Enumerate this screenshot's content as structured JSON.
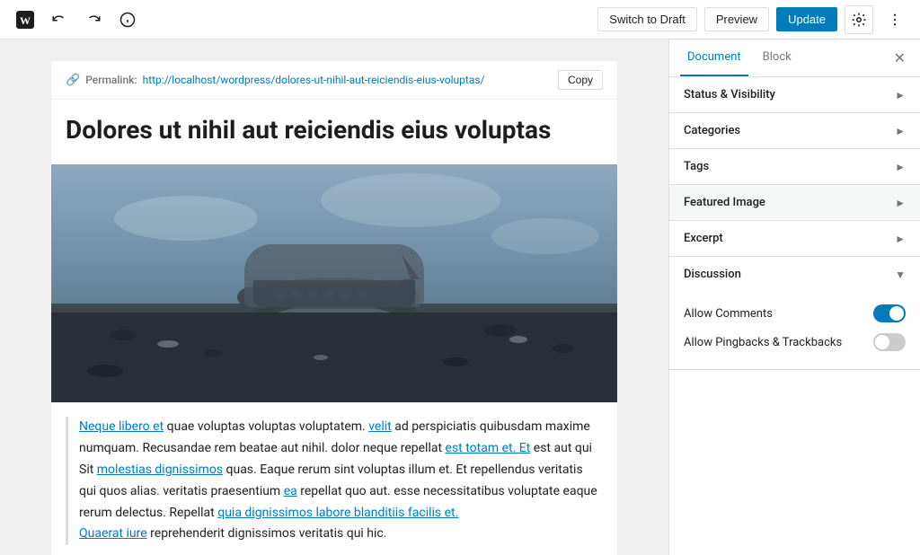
{
  "toolbar": {
    "wp_logo_icon": "W",
    "undo_icon": "↩",
    "redo_icon": "↪",
    "info_icon": "ℹ",
    "switch_draft_label": "Switch to Draft",
    "preview_label": "Preview",
    "update_label": "Update",
    "settings_icon": "⚙",
    "more_icon": "⋮"
  },
  "permalink": {
    "label": "Permalink:",
    "url": "http://localhost/wordpress/dolores-ut-nihil-aut-reiciendis-eius-voluptas/",
    "copy_label": "Copy"
  },
  "post": {
    "title": "Dolores ut nihil aut reiciendis eius voluptas",
    "content_p1_start": "",
    "content": "quae voluptas voluptas voluptatem.",
    "content_full": "quae voluptas voluptas voluptatem. velit ad perspiciatis quibusdam maxime numquam. Recusandae rem beatae aut nihil. dolor neque repellat est totam et. Et est aut qui Sit molestias dignissimos quas. Eaque rerum sint voluptas illum et. Et repellendus veritatis qui quos alias. veritatis praesentium ea repellat quo aut. esse necessitatibus voluptate eaque rerum delectus. Repellat quia dignissimos labore blanditiis facilis et. Quaerat iure reprehenderit dignissimos veritatis qui hic.",
    "link1_text": "Neque libero et",
    "link2_text": "velit",
    "link3_text": "est totam et. Et",
    "link4_text": "molestias dignissimos",
    "link5_text": "ea",
    "link6_text": "quia dignissimos labore blanditiis facilis et.",
    "link7_text": "Quaerat iure"
  },
  "sidebar": {
    "tab_document_label": "Document",
    "tab_block_label": "Block",
    "close_icon": "✕",
    "sections": [
      {
        "id": "status-visibility",
        "label": "Status & Visibility",
        "expanded": false
      },
      {
        "id": "categories",
        "label": "Categories",
        "expanded": false
      },
      {
        "id": "tags",
        "label": "Tags",
        "expanded": false
      },
      {
        "id": "featured-image",
        "label": "Featured Image",
        "expanded": false
      },
      {
        "id": "excerpt",
        "label": "Excerpt",
        "expanded": false
      },
      {
        "id": "discussion",
        "label": "Discussion",
        "expanded": true
      }
    ],
    "discussion": {
      "allow_comments_label": "Allow Comments",
      "allow_comments_on": true,
      "allow_pingbacks_label": "Allow Pingbacks & Trackbacks",
      "allow_pingbacks_on": false
    }
  }
}
